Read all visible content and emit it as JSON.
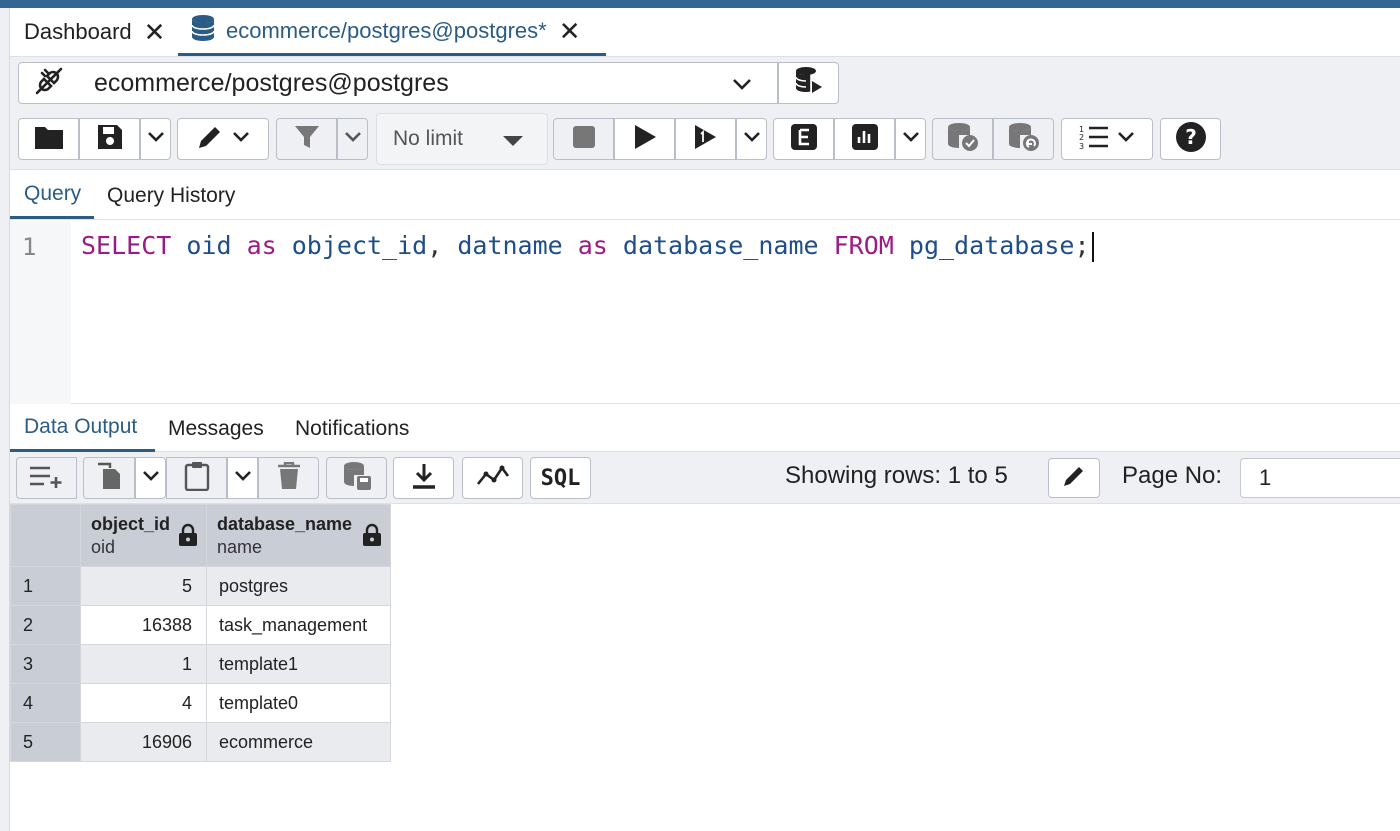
{
  "tabs": [
    {
      "label": "Dashboard"
    },
    {
      "label": "ecommerce/postgres@postgres*"
    }
  ],
  "connection": {
    "value": "ecommerce/postgres@postgres"
  },
  "toolbar": {
    "limit_label": "No limit"
  },
  "query_tabs": [
    {
      "label": "Query"
    },
    {
      "label": "Query History"
    }
  ],
  "editor": {
    "line_number": "1",
    "tokens": {
      "t1": "SELECT",
      "t2": " oid ",
      "t3": "as",
      "t4": " object_id",
      "t5": ", ",
      "t6": "datname ",
      "t7": "as",
      "t8": " database_name ",
      "t9": "FROM",
      "t10": " pg_database",
      "t11": ";"
    }
  },
  "output_tabs": [
    {
      "label": "Data Output"
    },
    {
      "label": "Messages"
    },
    {
      "label": "Notifications"
    }
  ],
  "output_toolbar": {
    "sql_label": "SQL",
    "rows_info": "Showing rows: 1 to 5",
    "page_label": "Page No:",
    "page_value": "1"
  },
  "grid": {
    "columns": [
      {
        "name": "object_id",
        "type": "oid"
      },
      {
        "name": "database_name",
        "type": "name"
      }
    ],
    "rows": [
      {
        "n": "1",
        "object_id": "5",
        "database_name": "postgres"
      },
      {
        "n": "2",
        "object_id": "16388",
        "database_name": "task_management"
      },
      {
        "n": "3",
        "object_id": "1",
        "database_name": "template1"
      },
      {
        "n": "4",
        "object_id": "4",
        "database_name": "template0"
      },
      {
        "n": "5",
        "object_id": "16906",
        "database_name": "ecommerce"
      }
    ]
  },
  "colors": {
    "accent": "#2a5c86",
    "keyword": "#9c1a86",
    "identifier": "#1d4e89",
    "topbar": "#336791"
  }
}
